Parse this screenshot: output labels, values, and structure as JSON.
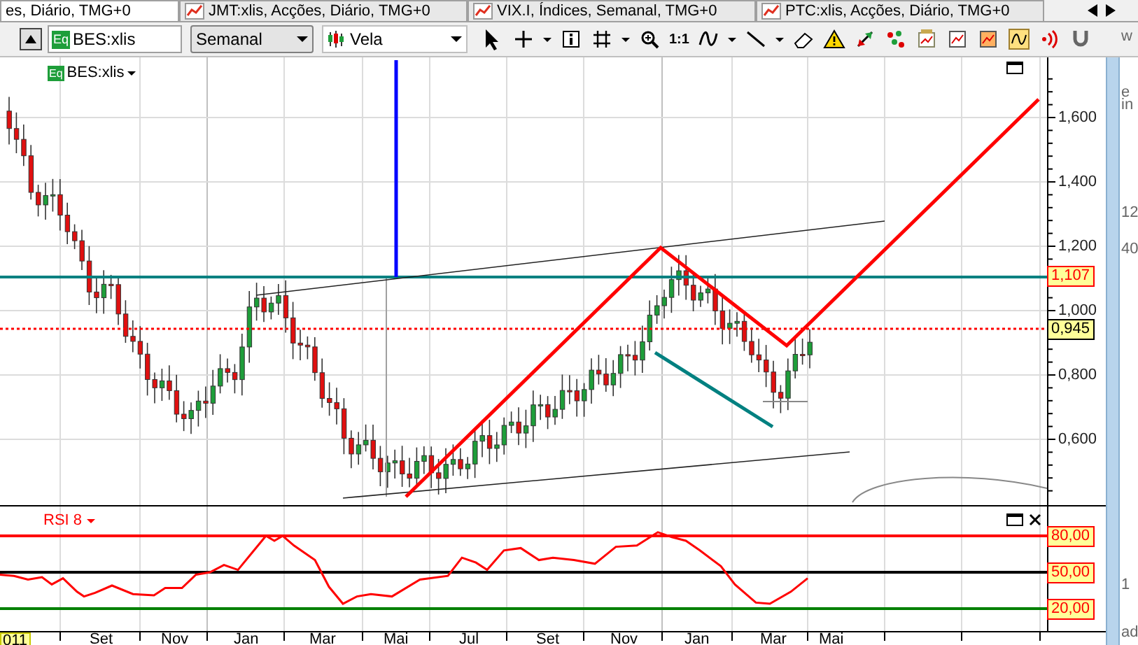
{
  "tabs": [
    {
      "label": "es, Diário, TMG+0",
      "selected": true
    },
    {
      "label": "JMT:xlis, Acções, Diário, TMG+0",
      "selected": false
    },
    {
      "label": "VIX.I, Índices, Semanal, TMG+0",
      "selected": false
    },
    {
      "label": "PTC:xlis, Acções, Diário, TMG+0",
      "selected": false
    }
  ],
  "toolbar": {
    "symbol_badge": "Eq",
    "symbol": "BES:xlis",
    "period": "Semanal",
    "chart_style": "Vela",
    "zoom_label": "1:1"
  },
  "price_panel": {
    "badge": "Eq",
    "title": "BES:xlis",
    "ticks": [
      "1,600",
      "1,400",
      "1,200",
      "1,000",
      "0,800",
      "0,600"
    ],
    "markers": [
      {
        "label": "1,107",
        "color": "#ff0000"
      },
      {
        "label": "0,945",
        "color": "#000000"
      }
    ]
  },
  "rsi_panel": {
    "title": "RSI 8",
    "levels": [
      {
        "label": "80,00",
        "color": "#ff0000"
      },
      {
        "label": "50,00",
        "color": "#000000"
      },
      {
        "label": "20,00",
        "color": "#008000"
      }
    ]
  },
  "time_axis": [
    {
      "label": "011",
      "selected": true
    },
    {
      "label": "Set",
      "selected": false
    },
    {
      "label": "Nov",
      "selected": false
    },
    {
      "label": "Jan",
      "selected": false
    },
    {
      "label": "Mar",
      "selected": false
    },
    {
      "label": "Mai",
      "selected": false
    },
    {
      "label": "Jul",
      "selected": false
    },
    {
      "label": "Set",
      "selected": false
    },
    {
      "label": "Nov",
      "selected": false
    },
    {
      "label": "Jan",
      "selected": false
    },
    {
      "label": "Mar",
      "selected": false
    },
    {
      "label": "Mai",
      "selected": false
    }
  ],
  "side_panel_fragments": [
    "w",
    "e",
    "in",
    "12",
    "40",
    "1",
    "ad"
  ]
}
